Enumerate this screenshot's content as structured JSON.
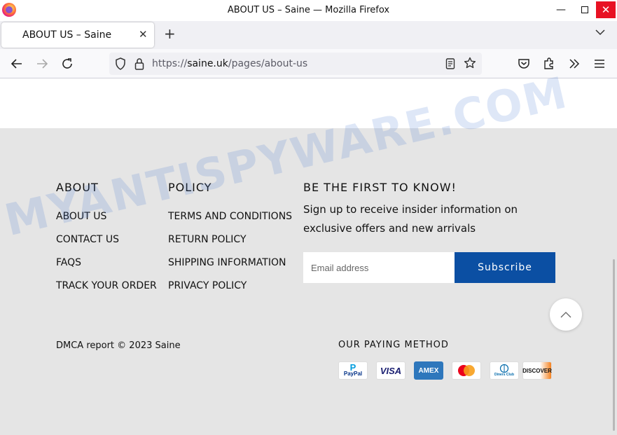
{
  "window": {
    "title": "ABOUT US – Saine — Mozilla Firefox",
    "minimize": "—",
    "close": "✕"
  },
  "tab": {
    "title": "ABOUT US – Saine",
    "close": "✕",
    "new_tab": "+",
    "list_all": "⌄"
  },
  "urlbar": {
    "scheme": "https://",
    "host": "saine.uk",
    "path": "/pages/about-us"
  },
  "footer": {
    "about": {
      "heading": "ABOUT",
      "links": [
        "ABOUT US",
        "CONTACT US",
        "FAQS",
        "TRACK YOUR ORDER"
      ]
    },
    "policy": {
      "heading": "POLICY",
      "links": [
        "TERMS AND CONDITIONS",
        "RETURN POLICY",
        "SHIPPING INFORMATION",
        "PRIVACY POLICY"
      ]
    },
    "newsletter": {
      "heading": "BE THE FIRST TO KNOW!",
      "text": "Sign up to receive insider information on exclusive offers and new arrivals",
      "email_placeholder": "Email address",
      "subscribe_label": "Subscribe"
    },
    "copyright": "DMCA report © 2023 Saine",
    "payment": {
      "heading": "OUR PAYING METHOD",
      "methods": [
        "PayPal",
        "VISA",
        "AMEX",
        "Mastercard",
        "Diners Club",
        "DISCOVER"
      ]
    }
  },
  "watermark": "MYANTISPYWARE.COM",
  "colors": {
    "subscribe_bg": "#0b4fa3",
    "footer_bg": "#e5e5e5",
    "close_bg": "#e81123"
  }
}
